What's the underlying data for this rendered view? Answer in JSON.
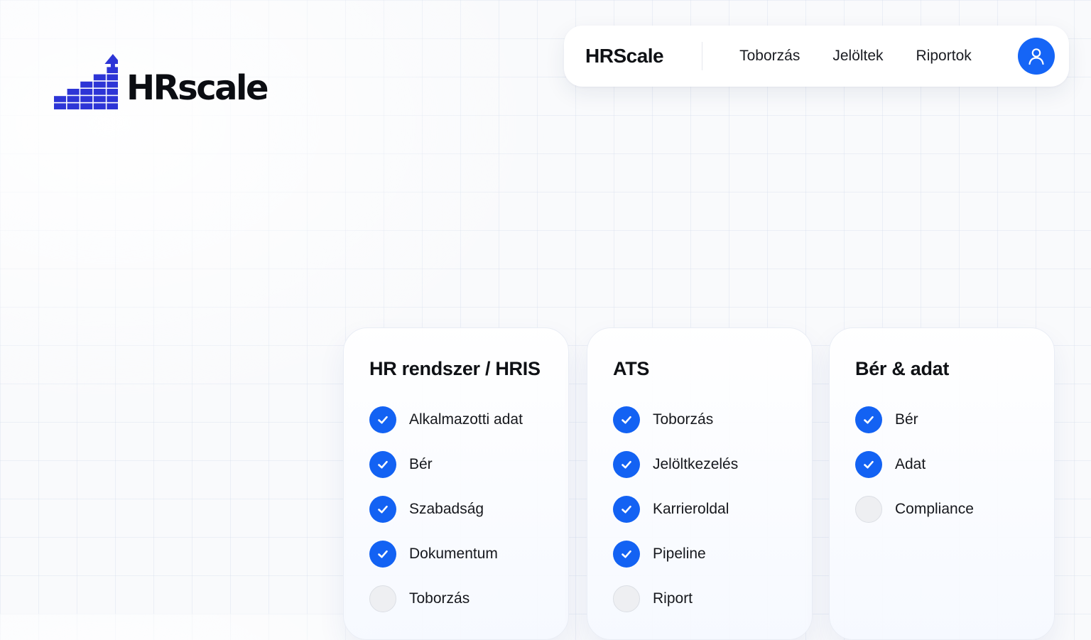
{
  "logo": {
    "wordmark": "HRscale",
    "icon": "bar-chart-up-arrow-icon",
    "color": "#2d35d6"
  },
  "navbar": {
    "brand": "HRScale",
    "links": [
      "Toborzás",
      "Jelöltek",
      "Riportok"
    ],
    "avatar_icon": "user-icon",
    "accent": "#1565f6"
  },
  "cards": [
    {
      "title": "HR rendszer / HRIS",
      "items": [
        {
          "label": "Alkalmazotti adat",
          "checked": true
        },
        {
          "label": "Bér",
          "checked": true
        },
        {
          "label": "Szabadság",
          "checked": true
        },
        {
          "label": "Dokumentum",
          "checked": true
        },
        {
          "label": "Toborzás",
          "checked": false
        }
      ]
    },
    {
      "title": "ATS",
      "items": [
        {
          "label": "Toborzás",
          "checked": true
        },
        {
          "label": "Jelöltkezelés",
          "checked": true
        },
        {
          "label": "Karrieroldal",
          "checked": true
        },
        {
          "label": "Pipeline",
          "checked": true
        },
        {
          "label": "Riport",
          "checked": false
        }
      ]
    },
    {
      "title": "Bér & adat",
      "items": [
        {
          "label": "Bér",
          "checked": true
        },
        {
          "label": "Adat",
          "checked": true
        },
        {
          "label": "Compliance",
          "checked": false
        }
      ]
    }
  ]
}
